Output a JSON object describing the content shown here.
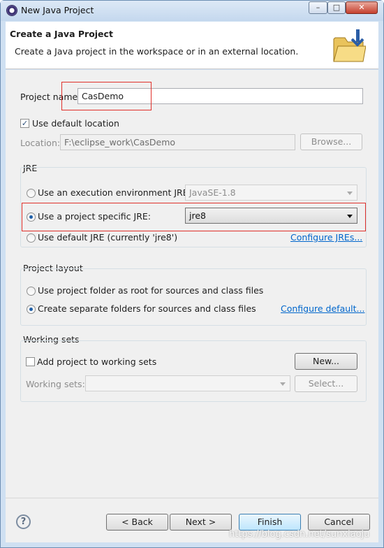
{
  "window": {
    "title": "New Java Project",
    "minimize": "–",
    "maximize": "□",
    "close": "✕"
  },
  "header": {
    "title": "Create a Java Project",
    "description": "Create a Java project in the workspace or in an external location."
  },
  "project": {
    "name_label": "Project name:",
    "name_value": "CasDemo",
    "use_default_label": "Use default location",
    "use_default_checked": true,
    "location_label": "Location:",
    "location_value": "F:\\eclipse_work\\CasDemo",
    "browse_label": "Browse..."
  },
  "jre": {
    "group_label": "JRE",
    "exec_env_label": "Use an execution environment JRE:",
    "exec_env_value": "JavaSE-1.8",
    "specific_label": "Use a project specific JRE:",
    "specific_value": "jre8",
    "default_label": "Use default JRE (currently 'jre8')",
    "configure_link": "Configure JREs...",
    "selected": "specific"
  },
  "layout": {
    "group_label": "Project layout",
    "option_root": "Use project folder as root for sources and class files",
    "option_separate": "Create separate folders for sources and class files",
    "configure_link": "Configure default...",
    "selected": "separate"
  },
  "working_sets": {
    "group_label": "Working sets",
    "add_label": "Add project to working sets",
    "add_checked": false,
    "new_label": "New...",
    "sets_label": "Working sets:",
    "select_label": "Select..."
  },
  "footer": {
    "help": "?",
    "back": "< Back",
    "next": "Next >",
    "finish": "Finish",
    "cancel": "Cancel"
  },
  "watermark": "https://blog.csdn.net/sunxiaoju",
  "colors": {
    "accent": "#0066cc",
    "highlight_box": "#e0302a",
    "title_bar": "#c4d8ee"
  }
}
